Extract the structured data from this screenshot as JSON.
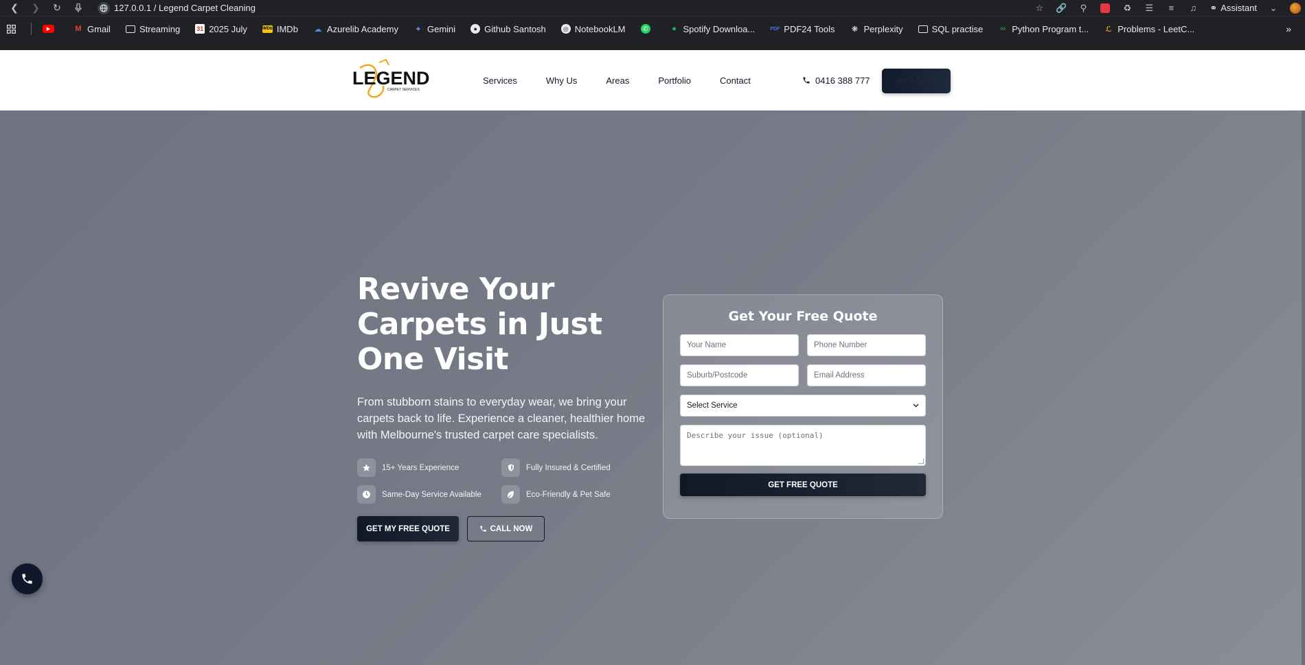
{
  "browser": {
    "url": "127.0.0.1 / Legend Carpet Cleaning",
    "assistant_label": "Assistant"
  },
  "bookmarks": [
    {
      "label": "",
      "icon": "youtube-icon"
    },
    {
      "label": "Gmail",
      "icon": "gmail-icon"
    },
    {
      "label": "Streaming",
      "icon": "folder-icon"
    },
    {
      "label": "2025 July",
      "icon": "calendar-icon"
    },
    {
      "label": "IMDb",
      "icon": "imdb-icon"
    },
    {
      "label": "Azurelib Academy",
      "icon": "cloud-icon"
    },
    {
      "label": "Gemini",
      "icon": "gemini-icon"
    },
    {
      "label": "Github Santosh",
      "icon": "github-icon"
    },
    {
      "label": "NotebookLM",
      "icon": "notebooklm-icon"
    },
    {
      "label": "",
      "icon": "whatsapp-icon"
    },
    {
      "label": "Spotify  Downloa...",
      "icon": "spotify-icon"
    },
    {
      "label": "PDF24 Tools",
      "icon": "pdf24-icon"
    },
    {
      "label": "Perplexity",
      "icon": "perplexity-icon"
    },
    {
      "label": "SQL practise",
      "icon": "folder-icon"
    },
    {
      "label": "Python Program t...",
      "icon": "python-icon"
    },
    {
      "label": "Problems - LeetC...",
      "icon": "leetcode-icon"
    }
  ],
  "header": {
    "logo_text": "LEGEND",
    "logo_sub": "CARPET SERVICES",
    "nav": [
      "Services",
      "Why Us",
      "Areas",
      "Portfolio",
      "Contact"
    ],
    "phone": "0416 388 777",
    "cta_label": "Get a Quote"
  },
  "hero": {
    "title_lines": [
      "Revive Your",
      "Carpets in Just",
      "One Visit"
    ],
    "subtitle": "From stubborn stains to everyday wear, we bring your carpets back to life. Experience a cleaner, healthier home with Melbourne's trusted carpet care specialists.",
    "features": [
      {
        "label": "15+ Years Experience",
        "icon": "star-icon"
      },
      {
        "label": "Fully Insured & Certified",
        "icon": "shield-icon"
      },
      {
        "label": "Same-Day Service Available",
        "icon": "clock-icon"
      },
      {
        "label": "Eco-Friendly & Pet Safe",
        "icon": "leaf-icon"
      }
    ],
    "primary_btn": "GET MY FREE QUOTE",
    "secondary_btn": "CALL NOW"
  },
  "quote_form": {
    "title": "Get Your Free Quote",
    "name_placeholder": "Your Name",
    "phone_placeholder": "Phone Number",
    "suburb_placeholder": "Suburb/Postcode",
    "email_placeholder": "Email Address",
    "select_value": "Select Service",
    "message_placeholder": "Describe your issue (optional)",
    "submit_label": "GET FREE QUOTE"
  },
  "colors": {
    "dark": "#111827",
    "hero_bg": "#767a86",
    "logo_accent": "#f0a81d"
  }
}
